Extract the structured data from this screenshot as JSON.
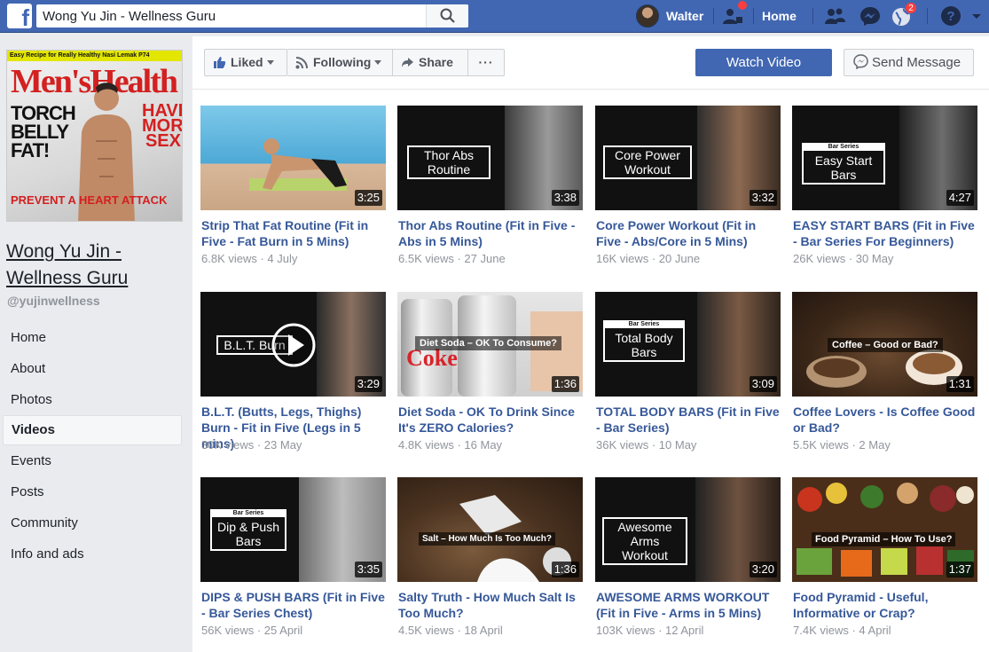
{
  "topbar": {
    "search_value": "Wong Yu Jin - Wellness Guru",
    "user_name": "Walter",
    "home_label": "Home",
    "notifications_count": "2"
  },
  "page": {
    "cover_strip": "Easy Recipe for Really Healthy Nasi Lemak P74",
    "cover_logo": "Men'sHealth",
    "cover_headline": "TORCH BELLY FAT!",
    "cover_side": "HAVE MORE SEX",
    "cover_heart": "PREVENT A HEART ATTACK",
    "name": "Wong Yu Jin - Wellness Guru",
    "handle": "@yujinwellness"
  },
  "nav": [
    "Home",
    "About",
    "Photos",
    "Videos",
    "Events",
    "Posts",
    "Community",
    "Info and ads"
  ],
  "nav_active": "Videos",
  "actions": {
    "liked": "Liked",
    "following": "Following",
    "share": "Share",
    "more": "···",
    "watch_video": "Watch Video",
    "send_message": "Send Message"
  },
  "videos": [
    {
      "title": "Strip That Fat Routine (Fit in Five - Fat Burn in 5 Mins)",
      "duration": "3:25",
      "meta": "6.8K views · 4 July",
      "overlay": ""
    },
    {
      "title": "Thor Abs Routine (Fit in Five - Abs in 5 Mins)",
      "duration": "3:38",
      "meta": "6.5K views · 27 June",
      "overlay": "Thor Abs Routine"
    },
    {
      "title": "Core Power Workout (Fit in Five - Abs/Core in 5 Mins)",
      "duration": "3:32",
      "meta": "16K views · 20 June",
      "overlay": "Core Power Workout"
    },
    {
      "title": "EASY START BARS (Fit in Five - Bar Series For Beginners)",
      "duration": "4:27",
      "meta": "26K views · 30 May",
      "overlay": "Easy Start Bars"
    },
    {
      "title": "B.L.T. (Butts, Legs, Thighs) Burn - Fit in Five (Legs in 5 mins)",
      "duration": "3:29",
      "meta": "30K views · 23 May",
      "overlay": "B.L.T. Burn"
    },
    {
      "title": "Diet Soda - OK To Drink Since It's ZERO Calories?",
      "duration": "1:36",
      "meta": "4.8K views · 16 May",
      "overlay": "Diet Soda – OK To Consume?"
    },
    {
      "title": "TOTAL BODY BARS (Fit in Five - Bar Series)",
      "duration": "3:09",
      "meta": "36K views · 10 May",
      "overlay": "Total Body Bars"
    },
    {
      "title": "Coffee Lovers - Is Coffee Good or Bad?",
      "duration": "1:31",
      "meta": "5.5K views · 2 May",
      "overlay": "Coffee – Good or Bad?"
    },
    {
      "title": "DIPS & PUSH BARS (Fit in Five - Bar Series Chest)",
      "duration": "3:35",
      "meta": "56K views · 25 April",
      "overlay": "Dip & Push Bars"
    },
    {
      "title": "Salty Truth - How Much Salt Is Too Much?",
      "duration": "1:36",
      "meta": "4.5K views · 18 April",
      "overlay": "Salt – How Much Is Too Much?"
    },
    {
      "title": "AWESOME ARMS WORKOUT (Fit in Five - Arms in 5 Mins)",
      "duration": "3:20",
      "meta": "103K views · 12 April",
      "overlay": "Awesome Arms Workout"
    },
    {
      "title": "Food Pyramid - Useful, Informative or Crap?",
      "duration": "1:37",
      "meta": "7.4K views · 4 April",
      "overlay": "Food Pyramid – How To Use?"
    }
  ],
  "bar_series_tag": "Bar Series",
  "colors": {
    "brand": "#4267b2",
    "link": "#365899",
    "meta": "#90949c"
  }
}
